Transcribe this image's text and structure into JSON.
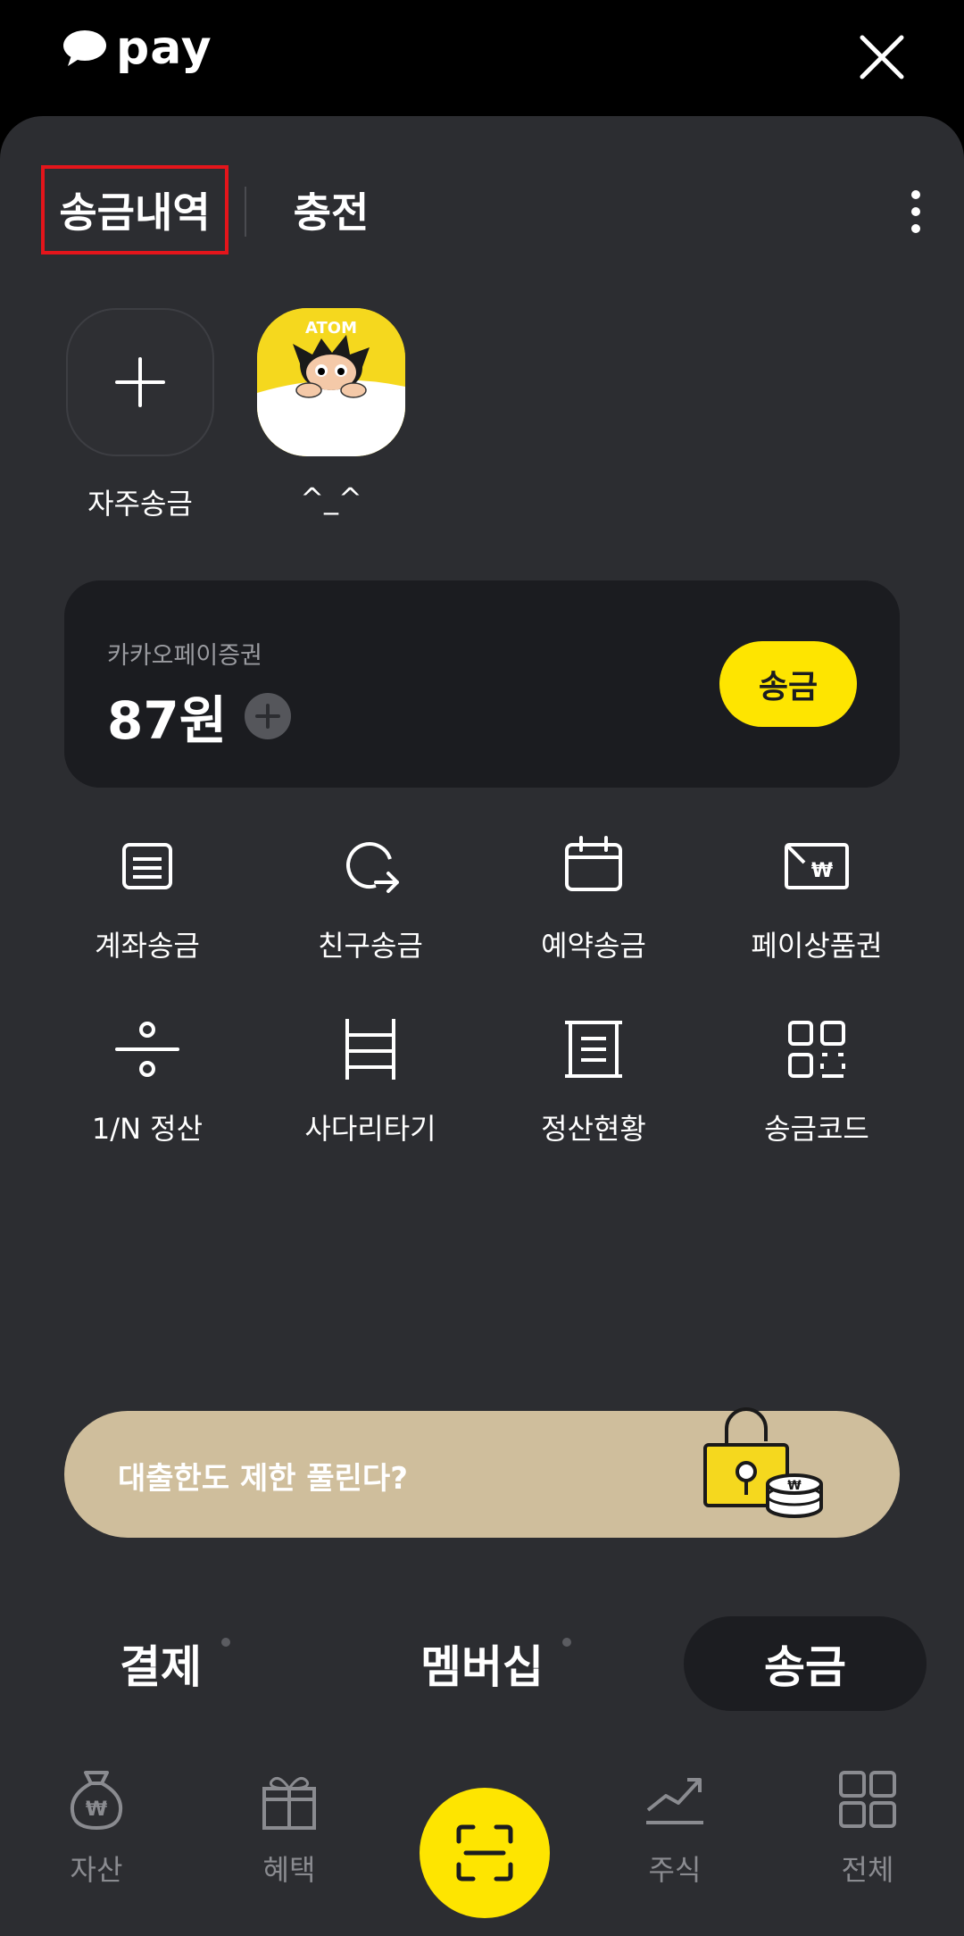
{
  "header": {
    "logo_text": "pay",
    "close_icon": "close-icon"
  },
  "tabs": {
    "history_label": "송금내역",
    "charge_label": "충전",
    "more_icon": "more-vertical-icon"
  },
  "favorites": [
    {
      "label": "자주송금",
      "icon": "plus-icon"
    },
    {
      "label": "^_^",
      "badge_text": "ATOM"
    }
  ],
  "balance_card": {
    "title": "카카오페이증권",
    "amount": "87원",
    "send_label": "송금"
  },
  "actions": [
    {
      "label": "계좌송금",
      "icon": "account-transfer-icon"
    },
    {
      "label": "친구송금",
      "icon": "friend-transfer-icon"
    },
    {
      "label": "예약송금",
      "icon": "calendar-icon"
    },
    {
      "label": "페이상품권",
      "icon": "gift-card-icon"
    },
    {
      "label": "1/N 정산",
      "icon": "split-bill-icon"
    },
    {
      "label": "사다리타기",
      "icon": "ladder-icon"
    },
    {
      "label": "정산현황",
      "icon": "receipt-icon"
    },
    {
      "label": "송금코드",
      "icon": "qr-code-icon"
    }
  ],
  "banner": {
    "text": "대출한도 제한 풀린다?"
  },
  "segment": {
    "pay_label": "결제",
    "membership_label": "멤버십",
    "send_label": "송금",
    "active": "송금"
  },
  "bottom_nav": [
    {
      "label": "자산",
      "icon": "money-bag-icon"
    },
    {
      "label": "혜택",
      "icon": "gift-icon"
    },
    {
      "label": "",
      "icon": "scan-icon"
    },
    {
      "label": "주식",
      "icon": "stock-chart-icon"
    },
    {
      "label": "전체",
      "icon": "grid-menu-icon"
    }
  ],
  "colors": {
    "background": "#000000",
    "sheet": "#2c2d31",
    "card": "#1b1c20",
    "accent_yellow": "#fee500",
    "banner": "#cfbe9c",
    "highlight_red": "#e4151b"
  }
}
